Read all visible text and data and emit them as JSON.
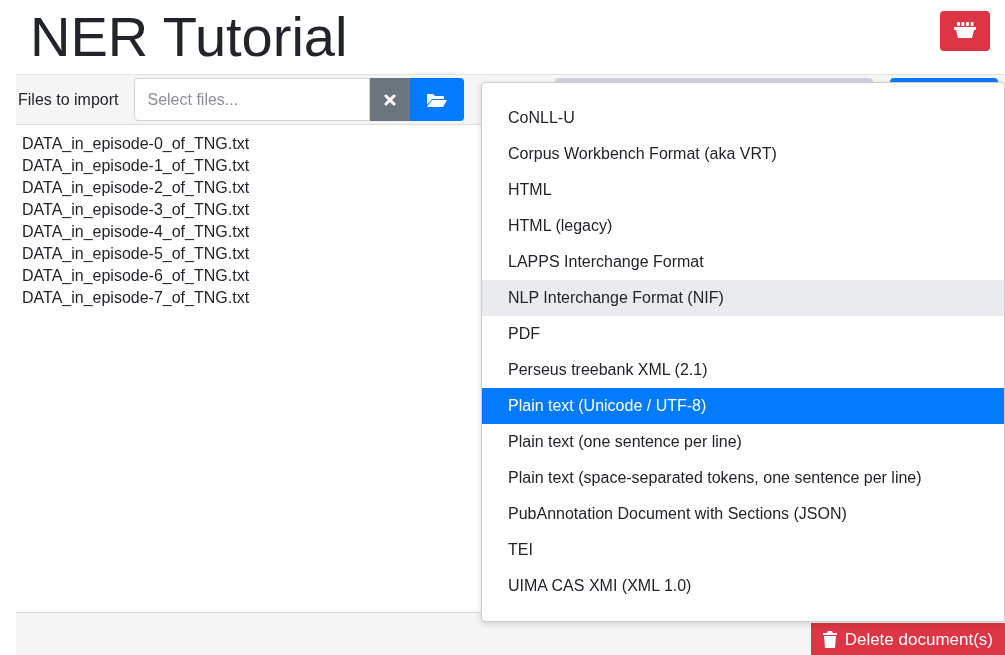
{
  "title": "NER Tutorial",
  "import_bar": {
    "label": "Files to import",
    "placeholder": "Select files..."
  },
  "files": [
    "DATA_in_episode-0_of_TNG.txt",
    "DATA_in_episode-1_of_TNG.txt",
    "DATA_in_episode-2_of_TNG.txt",
    "DATA_in_episode-3_of_TNG.txt",
    "DATA_in_episode-4_of_TNG.txt",
    "DATA_in_episode-5_of_TNG.txt",
    "DATA_in_episode-6_of_TNG.txt",
    "DATA_in_episode-7_of_TNG.txt"
  ],
  "format_dropdown": {
    "options": [
      {
        "label": "CoNLL-U",
        "selected": false,
        "hovered": false
      },
      {
        "label": "Corpus Workbench Format (aka VRT)",
        "selected": false,
        "hovered": false
      },
      {
        "label": "HTML",
        "selected": false,
        "hovered": false
      },
      {
        "label": "HTML (legacy)",
        "selected": false,
        "hovered": false
      },
      {
        "label": "LAPPS Interchange Format",
        "selected": false,
        "hovered": false
      },
      {
        "label": "NLP Interchange Format (NIF)",
        "selected": false,
        "hovered": true
      },
      {
        "label": "PDF",
        "selected": false,
        "hovered": false
      },
      {
        "label": "Perseus treebank XML (2.1)",
        "selected": false,
        "hovered": false
      },
      {
        "label": "Plain text (Unicode / UTF-8)",
        "selected": true,
        "hovered": false
      },
      {
        "label": "Plain text (one sentence per line)",
        "selected": false,
        "hovered": false
      },
      {
        "label": "Plain text (space-separated tokens, one sentence per line)",
        "selected": false,
        "hovered": false
      },
      {
        "label": "PubAnnotation Document with Sections (JSON)",
        "selected": false,
        "hovered": false
      },
      {
        "label": "TEI",
        "selected": false,
        "hovered": false
      },
      {
        "label": "UIMA CAS XMI (XML 1.0)",
        "selected": false,
        "hovered": false
      }
    ]
  },
  "delete_button": "Delete document(s)"
}
